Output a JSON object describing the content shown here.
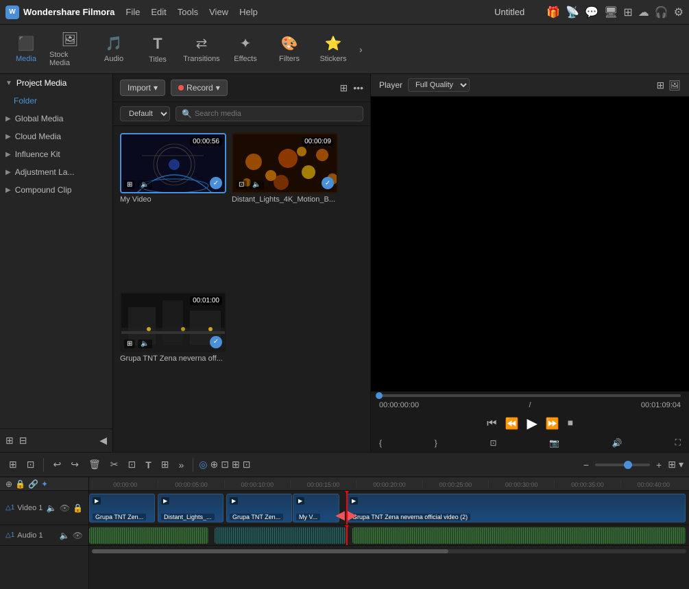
{
  "app": {
    "name": "Wondershare Filmora",
    "window_title": "Untitled"
  },
  "menu": {
    "items": [
      "File",
      "Edit",
      "Tools",
      "View",
      "Help"
    ]
  },
  "toolbar": {
    "items": [
      {
        "id": "media",
        "label": "Media",
        "icon": "🎬",
        "active": true
      },
      {
        "id": "stock-media",
        "label": "Stock Media",
        "icon": "📷"
      },
      {
        "id": "audio",
        "label": "Audio",
        "icon": "🎵"
      },
      {
        "id": "titles",
        "label": "Titles",
        "icon": "T"
      },
      {
        "id": "transitions",
        "label": "Transitions",
        "icon": "↔"
      },
      {
        "id": "effects",
        "label": "Effects",
        "icon": "✨"
      },
      {
        "id": "filters",
        "label": "Filters",
        "icon": "🎨"
      },
      {
        "id": "stickers",
        "label": "Stickers",
        "icon": "🌟"
      }
    ],
    "more": "›"
  },
  "left_panel": {
    "project_media_label": "Project Media",
    "folder_label": "Folder",
    "global_media_label": "Global Media",
    "cloud_media_label": "Cloud Media",
    "influence_kit_label": "Influence Kit",
    "adjustment_la_label": "Adjustment La...",
    "compound_clip_label": "Compound Clip"
  },
  "media_panel": {
    "import_label": "Import",
    "record_label": "Record",
    "default_label": "Default",
    "search_placeholder": "Search media",
    "items": [
      {
        "name": "My Video",
        "duration": "00:00:56",
        "selected": true
      },
      {
        "name": "Distant_Lights_4K_Motion_B...",
        "duration": "00:00:09"
      },
      {
        "name": "Grupa TNT Zena neverna off...",
        "duration": "00:01:00"
      }
    ]
  },
  "player": {
    "label": "Player",
    "quality": "Full Quality",
    "current_time": "00:00:00:00",
    "total_time": "00:01:09:04",
    "progress_pct": 0
  },
  "timeline": {
    "ruler_marks": [
      "00:00:00",
      "00:00:05:00",
      "00:00:10:00",
      "00:00:15:00",
      "00:00:20:00",
      "00:00:25:00",
      "00:00:30:00",
      "00:00:35:00",
      "00:00:40:00"
    ],
    "tracks": [
      {
        "id": "video1",
        "label": "Video 1",
        "num": "△1",
        "clips": [
          {
            "label": "Grupa TNT Zen...",
            "left_pct": 0,
            "width_pct": 11,
            "color": "blue"
          },
          {
            "label": "Distant_Lights_...",
            "left_pct": 11.5,
            "width_pct": 11,
            "color": "blue"
          },
          {
            "label": "Grupa TNT Zen...",
            "left_pct": 23,
            "width_pct": 11,
            "color": "blue"
          },
          {
            "label": "My V...",
            "left_pct": 34,
            "width_pct": 8,
            "color": "blue"
          },
          {
            "label": "Grupa TNT Zena neverna official video (2)",
            "left_pct": 43,
            "width_pct": 57,
            "color": "blue"
          }
        ]
      },
      {
        "id": "audio1",
        "label": "Audio 1",
        "num": "△1",
        "audio": true,
        "clips": [
          {
            "left_pct": 0,
            "width_pct": 20,
            "color": "green"
          },
          {
            "left_pct": 21,
            "width_pct": 22,
            "color": "teal"
          },
          {
            "left_pct": 44,
            "width_pct": 56,
            "color": "green"
          }
        ]
      }
    ],
    "playhead_pct": 43,
    "zoom_pct": 60
  },
  "timeline_toolbar": {
    "undo_label": "↩",
    "redo_label": "↪",
    "delete_label": "🗑",
    "cut_label": "✂",
    "crop_label": "⊡",
    "text_label": "T",
    "snap_label": "⊡",
    "more_label": "»",
    "zoom_minus": "−",
    "zoom_plus": "+"
  },
  "top_icons": [
    "🎁",
    "📡",
    "💬",
    "🖥",
    "⊞",
    "☁",
    "🎧",
    "⚙"
  ]
}
